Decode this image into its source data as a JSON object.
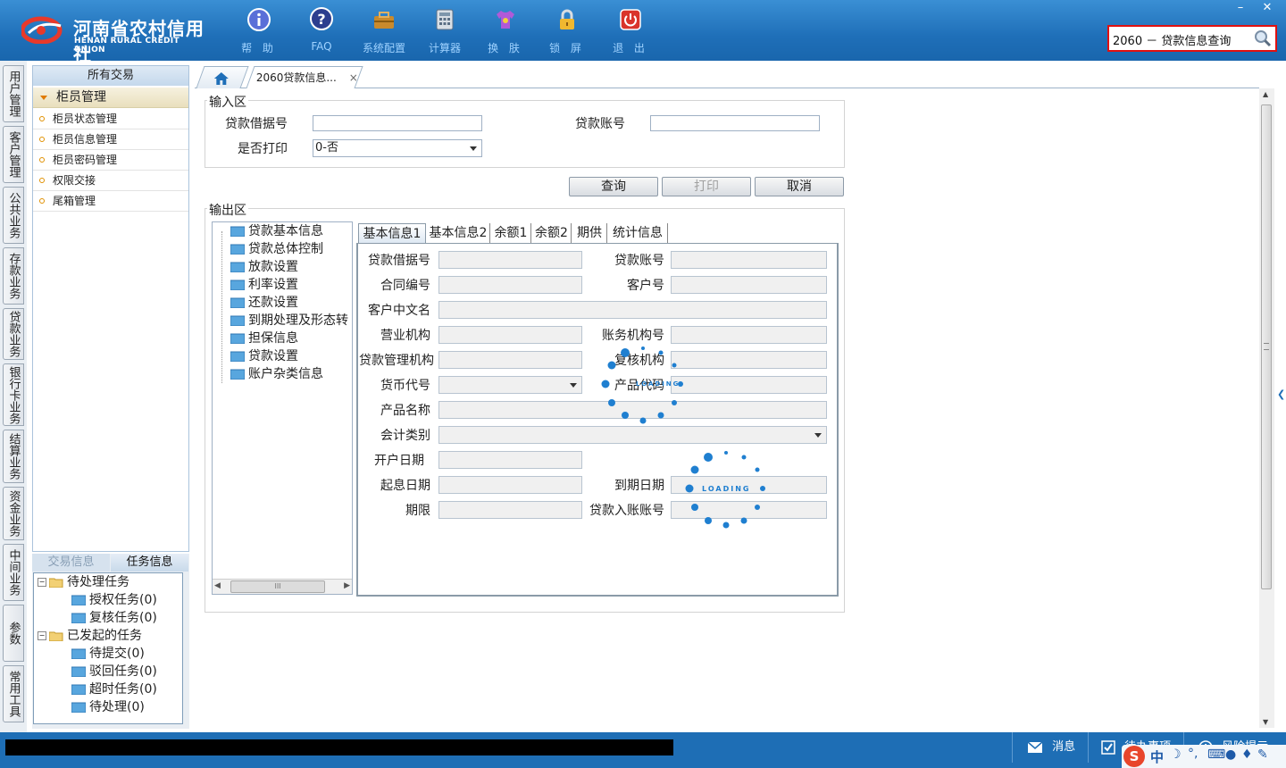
{
  "app": {
    "logo_cn": "河南省农村信用社",
    "logo_en": "HENAN RURAL CREDIT UNION"
  },
  "toolbar": [
    {
      "name": "help-button",
      "label": "帮 助",
      "icon": "info-icon"
    },
    {
      "name": "faq-button",
      "label": "FAQ",
      "icon": "question-icon"
    },
    {
      "name": "system-config-button",
      "label": "系统配置",
      "icon": "toolbox-icon"
    },
    {
      "name": "calculator-button",
      "label": "计算器",
      "icon": "calculator-icon"
    },
    {
      "name": "skin-button",
      "label": "换 肤",
      "icon": "shirt-icon"
    },
    {
      "name": "lock-screen-button",
      "label": "锁 屏",
      "icon": "lock-icon"
    },
    {
      "name": "exit-button",
      "label": "退 出",
      "icon": "power-icon"
    }
  ],
  "window": {
    "minimize": "–",
    "close": "✕"
  },
  "search": {
    "value": "2060 － 贷款信息查询"
  },
  "vertical_tabs": [
    "用户管理",
    "客户管理",
    "公共业务",
    "存款业务",
    "贷款业务",
    "银行卡业务",
    "结算业务",
    "资金业务",
    "中间业务",
    "参数",
    "常用工具"
  ],
  "nav": {
    "title": "所有交易",
    "group": "柜员管理",
    "items": [
      "柜员状态管理",
      "柜员信息管理",
      "柜员密码管理",
      "权限交接",
      "尾箱管理"
    ]
  },
  "task_panel": {
    "tabs": [
      "交易信息",
      "任务信息"
    ],
    "pending": "待处理任务",
    "pending_children": [
      "授权任务(0)",
      "复核任务(0)"
    ],
    "started": "已发起的任务",
    "started_children": [
      "待提交(0)",
      "驳回任务(0)",
      "超时任务(0)",
      "待处理(0)"
    ]
  },
  "content_tabs": {
    "active": "2060贷款信息...",
    "close": "×"
  },
  "input_area": {
    "legend": "输入区",
    "loan_note_label": "贷款借据号",
    "loan_account_label": "贷款账号",
    "print_label": "是否打印",
    "print_value": "0-否",
    "buttons": {
      "query": "查询",
      "print": "打印",
      "cancel": "取消"
    }
  },
  "output_area": {
    "legend": "输出区",
    "tree": [
      "贷款基本信息",
      "贷款总体控制",
      "放款设置",
      "利率设置",
      "还款设置",
      "到期处理及形态转",
      "担保信息",
      "贷款设置",
      "账户杂类信息"
    ],
    "scroll_grip": "III",
    "tabs": [
      "基本信息1",
      "基本信息2",
      "余额1",
      "余额2",
      "期供",
      "统计信息"
    ],
    "fields": {
      "loan_note_no": "贷款借据号",
      "loan_account": "贷款账号",
      "contract_no": "合同编号",
      "customer_no": "客户号",
      "customer_cn_name": "客户中文名",
      "business_org": "营业机构",
      "account_org_no": "账务机构号",
      "loan_mgmt_org": "贷款管理机构",
      "review_org": "复核机构",
      "currency_code": "货币代号",
      "product_code": "产品代码",
      "product_name": "产品名称",
      "accounting_type": "会计类别",
      "open_date": "开户日期",
      "value_date": "起息日期",
      "maturity_date": "到期日期",
      "term": "期限",
      "loan_credit_account": "贷款入账账号"
    },
    "loading_text": "LOADING"
  },
  "statusbar": {
    "message": "消息",
    "todo": "待办事项",
    "risk": "风险提示"
  },
  "ime": {
    "zh": "中"
  }
}
